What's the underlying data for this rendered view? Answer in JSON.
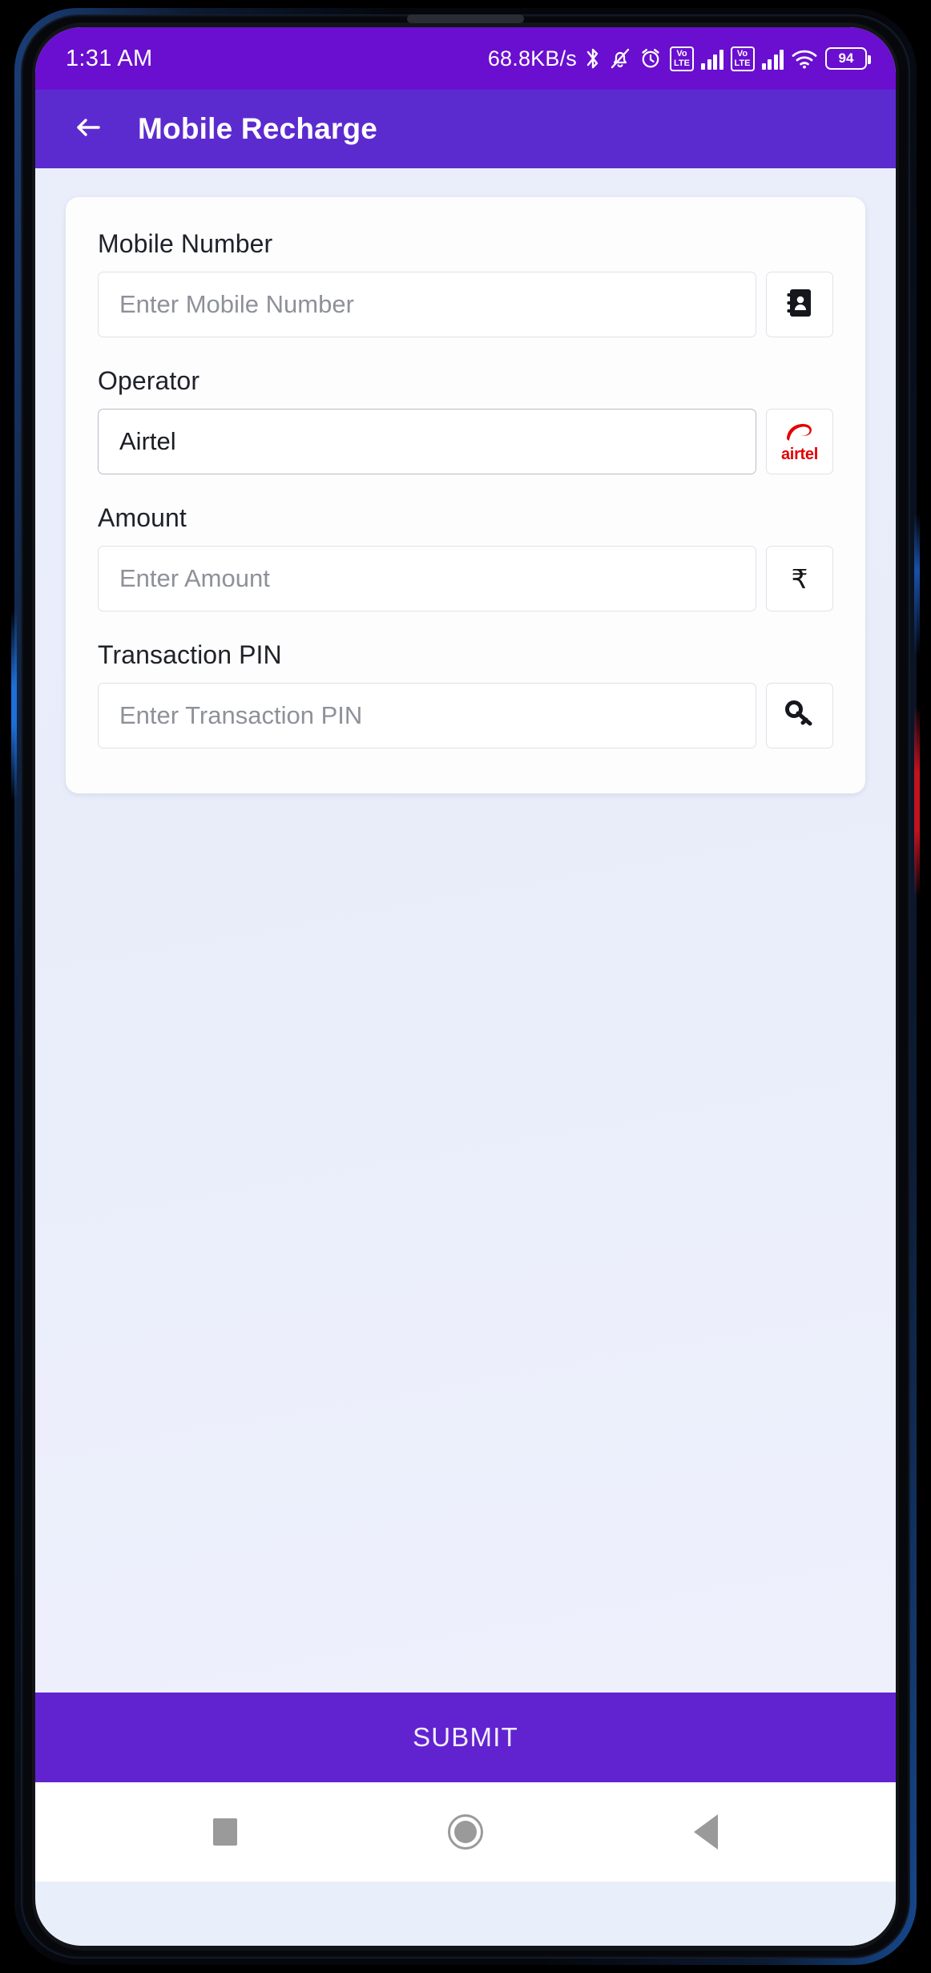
{
  "device": {
    "frame_color": "#05070c",
    "accent_edge_left": "#1f6fd8",
    "accent_edge_right": "#c1121f"
  },
  "status_bar": {
    "background": "#6a0fd0",
    "time": "1:31 AM",
    "network_speed": "68.8KB/s",
    "icons": [
      "bluetooth-icon",
      "notifications-silenced-icon",
      "alarm-icon",
      "volte-sim1-icon",
      "signal-sim1-icon",
      "volte-sim2-icon",
      "signal-sim2-icon",
      "wifi-icon"
    ],
    "volte_label_top": "Vo",
    "volte_label_bottom": "LTE",
    "battery_percent": "94"
  },
  "app_bar": {
    "background": "#5c2bd0",
    "back_icon": "arrow-left-icon",
    "title": "Mobile Recharge"
  },
  "form": {
    "fields": [
      {
        "label": "Mobile Number",
        "value": "",
        "placeholder": "Enter Mobile Number",
        "addon_icon": "contacts-book-icon"
      },
      {
        "label": "Operator",
        "value": "Airtel",
        "placeholder": "",
        "addon_icon": "airtel-logo-icon",
        "addon_text": "airtel",
        "addon_color": "#e40000"
      },
      {
        "label": "Amount",
        "value": "",
        "placeholder": "Enter Amount",
        "addon_icon": "rupee-icon",
        "addon_text": "₹"
      },
      {
        "label": "Transaction PIN",
        "value": "",
        "placeholder": "Enter Transaction PIN",
        "addon_icon": "key-icon"
      }
    ]
  },
  "submit": {
    "label": "SUBMIT",
    "background": "#6123cf"
  },
  "nav_bar": {
    "background": "#ffffff",
    "items": [
      {
        "name": "recents-button",
        "icon": "square-icon"
      },
      {
        "name": "home-button",
        "icon": "circle-icon"
      },
      {
        "name": "back-button",
        "icon": "triangle-left-icon"
      }
    ]
  }
}
